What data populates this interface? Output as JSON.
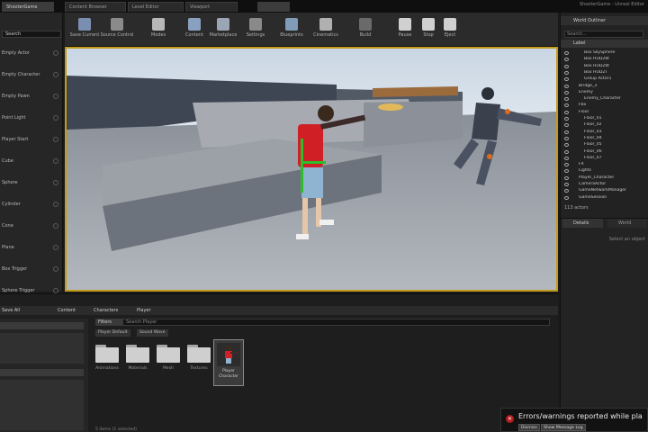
{
  "tabs": [
    "ShooterGame",
    "Content Browser",
    "Level Editor",
    "Viewport"
  ],
  "window_title_right": "ShooterGame - Unreal Editor",
  "modes": {
    "search_placeholder": "Search",
    "items": [
      "Empty Actor",
      "Empty Character",
      "Empty Pawn",
      "Point Light",
      "Player Start",
      "Cube",
      "Sphere",
      "Cylinder",
      "Cone",
      "Plane",
      "Box Trigger",
      "Sphere Trigger"
    ]
  },
  "toolbar": {
    "buttons": [
      {
        "label": "Save Current",
        "icon": "save-icon",
        "color": "#7a8fb0"
      },
      {
        "label": "Source Control",
        "icon": "source-control-icon",
        "color": "#8a8a8a"
      },
      {
        "label": "Modes",
        "icon": "modes-icon",
        "color": "#b8b8b8"
      },
      {
        "label": "Content",
        "icon": "content-icon",
        "color": "#8aa0c0"
      },
      {
        "label": "Marketplace",
        "icon": "marketplace-icon",
        "color": "#9aa5b5"
      },
      {
        "label": "Settings",
        "icon": "settings-icon",
        "color": "#8a8a8a"
      },
      {
        "label": "Blueprints",
        "icon": "blueprints-icon",
        "color": "#7f9bb5"
      },
      {
        "label": "Cinematics",
        "icon": "cinematics-icon",
        "color": "#b0b0b0"
      },
      {
        "label": "Build",
        "icon": "build-icon",
        "color": "#6a6a6a"
      },
      {
        "label": "Pause",
        "icon": "pause-icon",
        "color": "#d0d0d0"
      },
      {
        "label": "Stop",
        "icon": "stop-icon",
        "color": "#d0d0d0"
      },
      {
        "label": "Eject",
        "icon": "eject-icon",
        "color": "#d0d0d0"
      }
    ]
  },
  "outliner": {
    "tab": "World Outliner",
    "search_placeholder": "Search...",
    "column": "Label",
    "rows": [
      {
        "name": "Box SkySphere",
        "level": 2
      },
      {
        "name": "Box HUD2W",
        "level": 2
      },
      {
        "name": "Box HUD2W",
        "level": 2
      },
      {
        "name": "Box HUD2T",
        "level": 2
      },
      {
        "name": "Group Actor1",
        "level": 2
      },
      {
        "name": "Bridge_3",
        "level": 1
      },
      {
        "name": "Enemy",
        "level": 1
      },
      {
        "name": "Enemy_Character",
        "level": 2
      },
      {
        "name": "Fbx",
        "level": 1
      },
      {
        "name": "Floor",
        "level": 1
      },
      {
        "name": "Floor_01",
        "level": 2
      },
      {
        "name": "Floor_02",
        "level": 2
      },
      {
        "name": "Floor_03",
        "level": 2
      },
      {
        "name": "Floor_04",
        "level": 2
      },
      {
        "name": "Floor_05",
        "level": 2
      },
      {
        "name": "Floor_06",
        "level": 2
      },
      {
        "name": "Floor_07",
        "level": 2
      },
      {
        "name": "FX",
        "level": 1
      },
      {
        "name": "Lights",
        "level": 1
      },
      {
        "name": "Player_Character",
        "level": 1
      },
      {
        "name": "CameraActor",
        "level": 1
      },
      {
        "name": "GameNetworkManager",
        "level": 1
      },
      {
        "name": "GameSession",
        "level": 1
      }
    ],
    "count": "113 actors"
  },
  "details": {
    "tab": "Details",
    "tab2": "World",
    "empty_message": "Select an object"
  },
  "content_browser": {
    "path": [
      "Save All",
      "Content",
      "Characters",
      "Player"
    ],
    "filters_label": "Filters",
    "search_placeholder": "Search Player",
    "chips": [
      "Player Default",
      "Sound Wave"
    ],
    "folders": [
      "Animations",
      "Materials",
      "Mesh",
      "Textures"
    ],
    "asset_label": "Player Character",
    "status": "5 items (1 selected)"
  },
  "toast": {
    "message": "Errors/warnings reported while pla",
    "buttons": [
      "Dismiss",
      "Show Message Log"
    ]
  }
}
